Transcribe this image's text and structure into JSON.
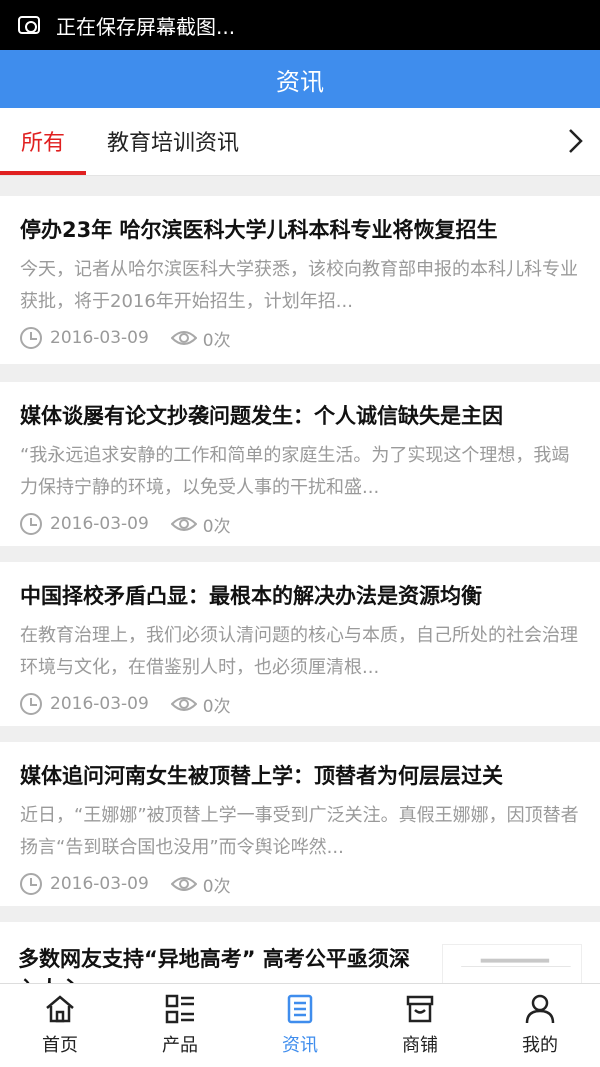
{
  "status_bar": {
    "text": "正在保存屏幕截图..."
  },
  "header": {
    "title": "资讯"
  },
  "tabs": [
    {
      "label": "所有",
      "active": true
    },
    {
      "label": "教育培训资讯",
      "active": false
    }
  ],
  "articles": [
    {
      "title": "停办23年 哈尔滨医科大学儿科本科专业将恢复招生",
      "summary": "今天，记者从哈尔滨医科大学获悉，该校向教育部申报的本科儿科专业获批，将于2016年开始招生，计划年招...",
      "date": "2016-03-09",
      "views": "0次"
    },
    {
      "title": "媒体谈屡有论文抄袭问题发生：个人诚信缺失是主因",
      "summary": "“我永远追求安静的工作和简单的家庭生活。为了实现这个理想，我竭力保持宁静的环境，以免受人事的干扰和盛...",
      "date": "2016-03-09",
      "views": "0次"
    },
    {
      "title": "中国择校矛盾凸显：最根本的解决办法是资源均衡",
      "summary": "在教育治理上，我们必须认清问题的核心与本质，自己所处的社会治理环境与文化，在借鉴别人时，也必须厘清根...",
      "date": "2016-03-09",
      "views": "0次"
    },
    {
      "title": "媒体追问河南女生被顶替上学：顶替者为何层层过关",
      "summary": "近日，“王娜娜”被顶替上学一事受到广泛关注。真假王娜娜，因顶替者扬言“告到联合国也没用”而令舆论哗然...",
      "date": "2016-03-09",
      "views": "0次"
    }
  ],
  "partial_article": {
    "title": "多数网友支持“异地高考” 高考公平亟须深入人心"
  },
  "bottom_nav": [
    {
      "label": "首页",
      "icon": "home-icon",
      "active": false
    },
    {
      "label": "产品",
      "icon": "grid-list-icon",
      "active": false
    },
    {
      "label": "资讯",
      "icon": "news-icon",
      "active": true
    },
    {
      "label": "商铺",
      "icon": "store-icon",
      "active": false
    },
    {
      "label": "我的",
      "icon": "user-icon",
      "active": false
    }
  ],
  "colors": {
    "accent_blue": "#3f8ded",
    "active_tab_red": "#e02020",
    "meta_gray": "#9a9a9a"
  }
}
